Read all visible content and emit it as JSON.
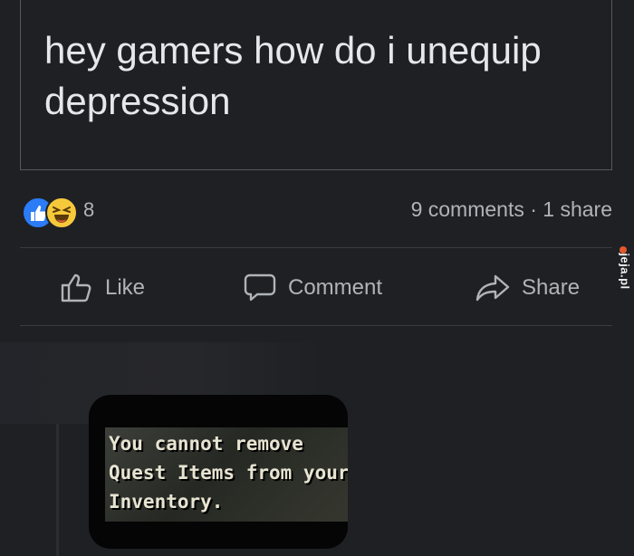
{
  "post": {
    "text": "hey gamers how do i unequip depression"
  },
  "stats": {
    "reaction_icons": [
      "like-reaction",
      "haha-reaction"
    ],
    "reaction_count": "8",
    "comments_shares": "9 comments · 1 share"
  },
  "actions": {
    "like_label": "Like",
    "comment_label": "Comment",
    "share_label": "Share"
  },
  "watermark": {
    "text": "jeja.pl"
  },
  "comment": {
    "image_text_lines": [
      "You cannot remove",
      "Quest Items from your",
      "Inventory."
    ]
  },
  "colors": {
    "background": "#1e2024",
    "text_primary": "#e4e6eb",
    "text_secondary": "#b0b3b8",
    "like_blue": "#2b7cf6",
    "haha_yellow": "#f6c93b"
  }
}
